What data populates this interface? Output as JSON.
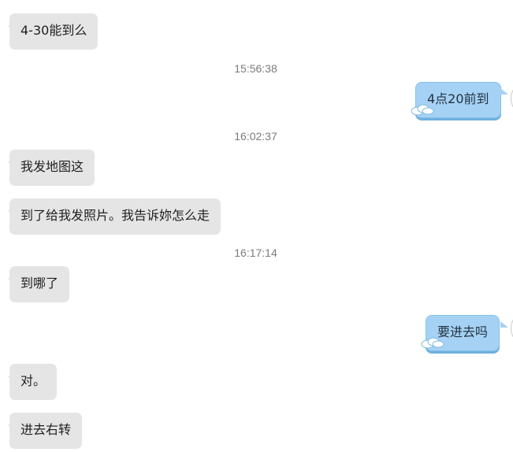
{
  "chat": {
    "messages": [
      {
        "side": "in",
        "text": "4-30能到么"
      },
      {
        "type": "timestamp",
        "text": "15:56:38"
      },
      {
        "side": "out",
        "text": "4点20前到"
      },
      {
        "type": "timestamp",
        "text": "16:02:37"
      },
      {
        "side": "in",
        "text": "我发地图这"
      },
      {
        "side": "in",
        "text": "到了给我发照片。我告诉妳怎么走"
      },
      {
        "type": "timestamp",
        "text": "16:17:14"
      },
      {
        "side": "in",
        "text": "到哪了"
      },
      {
        "side": "out",
        "text": "要进去吗"
      },
      {
        "side": "in",
        "text": "对。"
      },
      {
        "side": "in",
        "text": "进去右转"
      }
    ]
  },
  "colors": {
    "incoming_bubble": "#e5e5e5",
    "outgoing_bubble": "#a5d2f4",
    "timestamp_text": "#7b7b7b"
  }
}
